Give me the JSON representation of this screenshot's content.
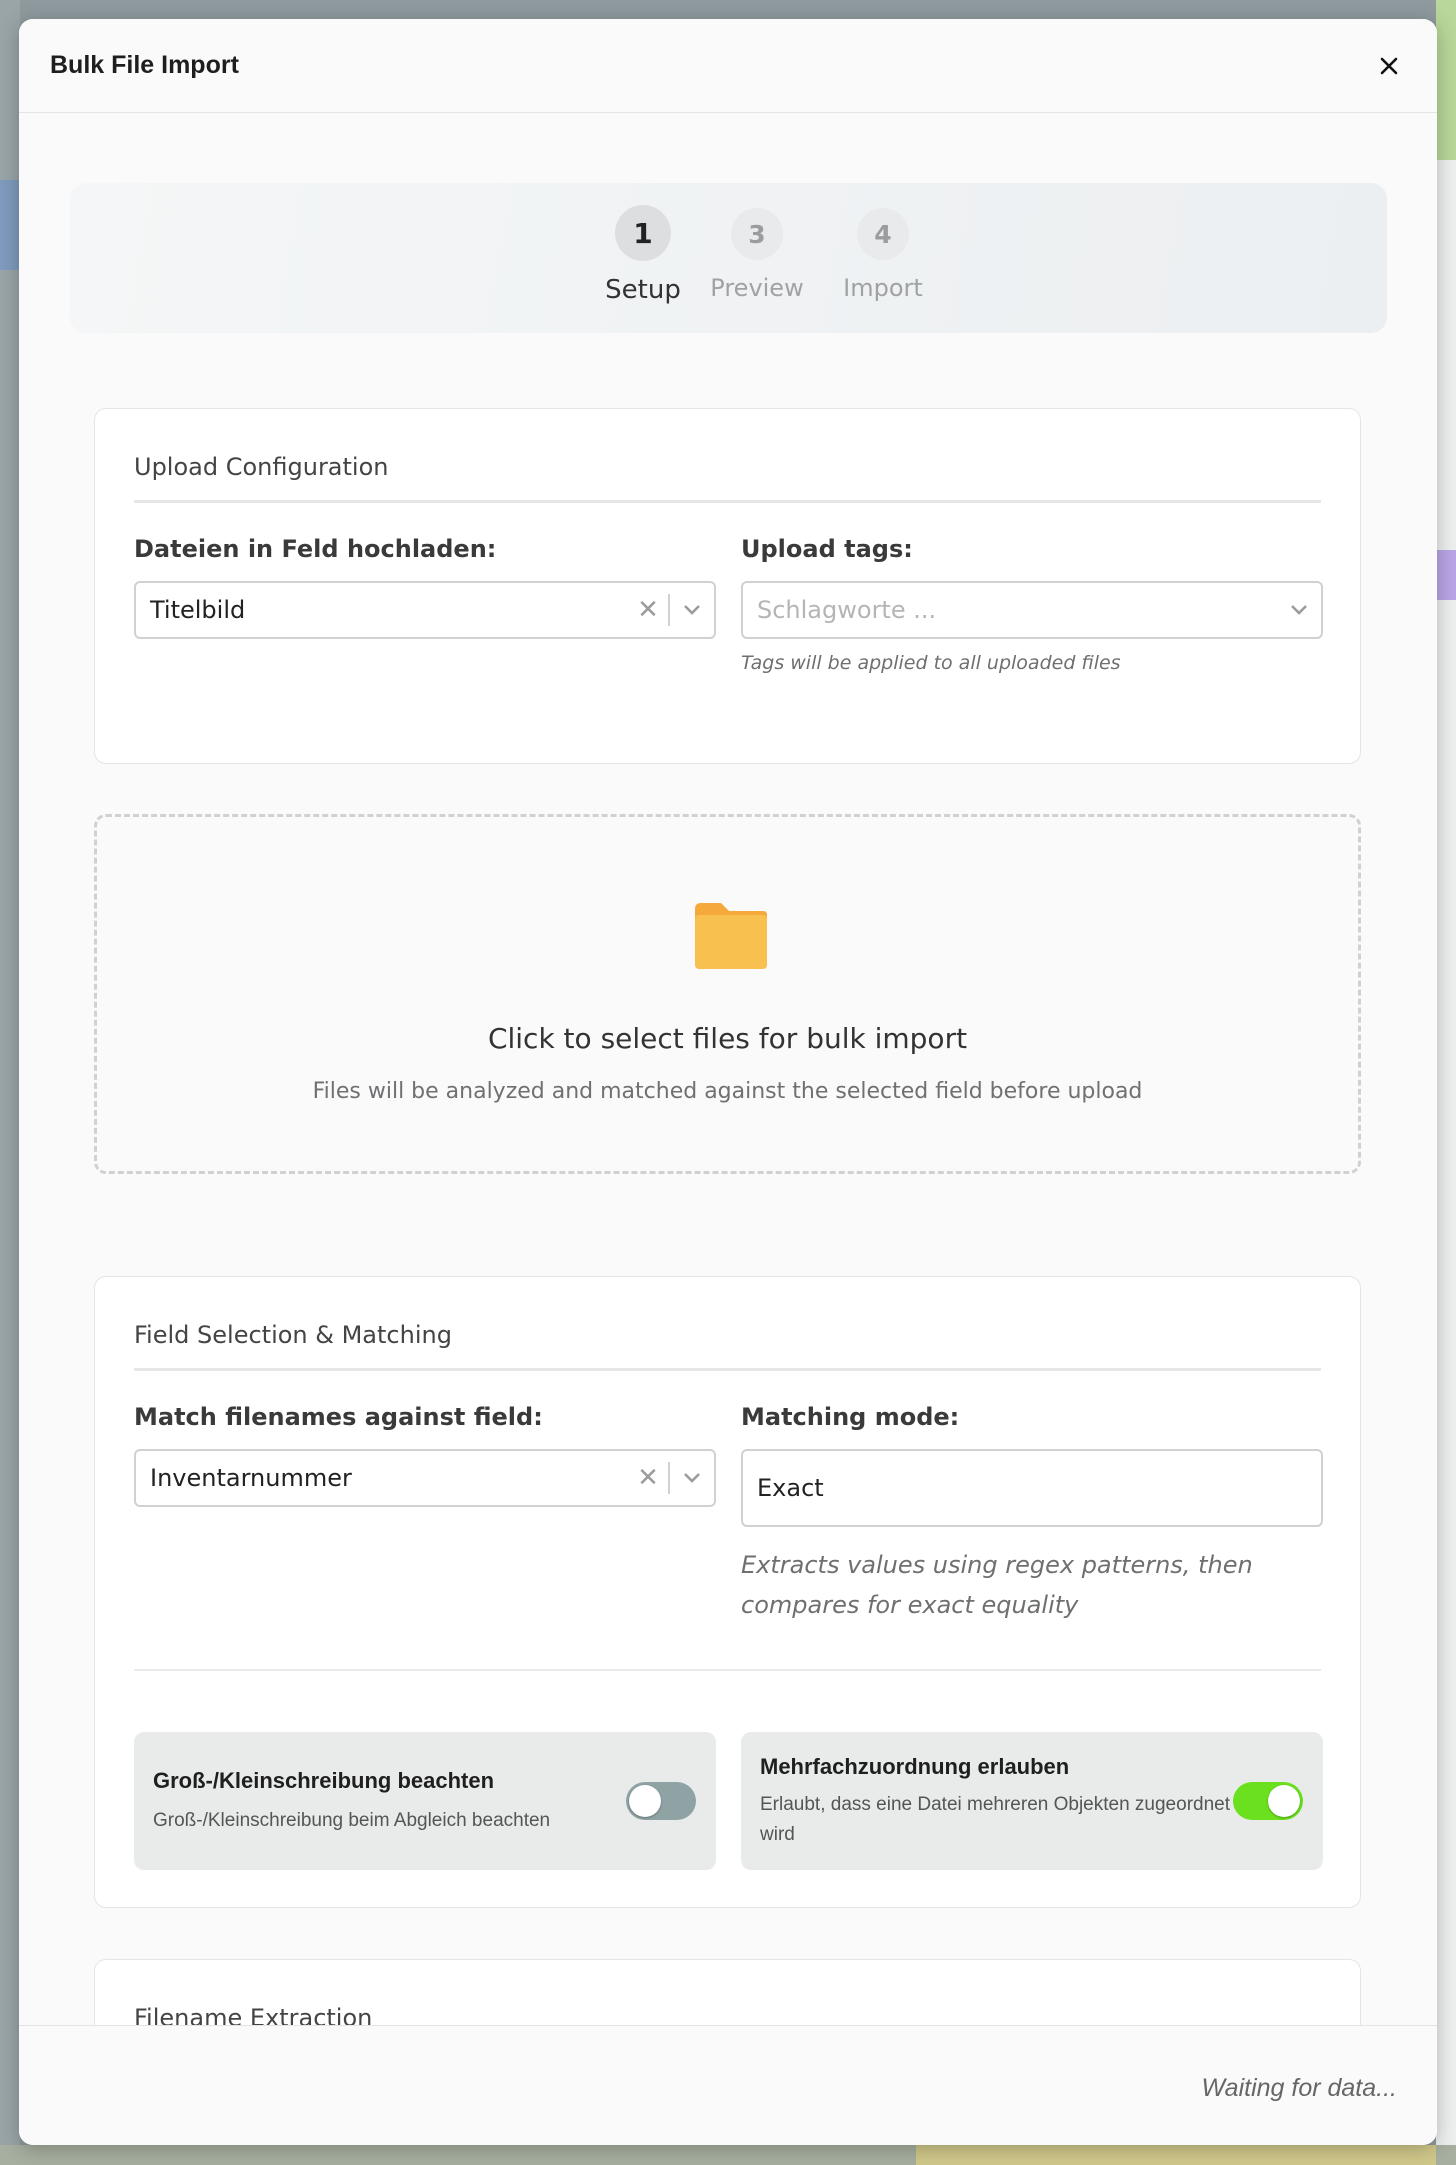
{
  "dialog": {
    "title": "Bulk File Import",
    "close_label": "×"
  },
  "stepper": {
    "steps": [
      {
        "number": "1",
        "label": "Setup",
        "state": "active"
      },
      {
        "number": "3",
        "label": "Preview",
        "state": "inactive"
      },
      {
        "number": "4",
        "label": "Import",
        "state": "inactive"
      }
    ]
  },
  "upload_config": {
    "title": "Upload Configuration",
    "field_label": "Dateien in Feld hochladen:",
    "field_value": "Titelbild",
    "tags_label": "Upload tags:",
    "tags_placeholder": "Schlagworte ...",
    "tags_help": "Tags will be applied to all uploaded files"
  },
  "dropzone": {
    "icon": "folder-icon",
    "title": "Click to select files for bulk import",
    "subtitle": "Files will be analyzed and matched against the selected field before upload"
  },
  "field_matching": {
    "title": "Field Selection & Matching",
    "match_label": "Match filenames against field:",
    "match_value": "Inventarnummer",
    "mode_label": "Matching mode:",
    "mode_value": "Exact",
    "mode_help": "Extracts values using regex patterns, then compares for exact equality",
    "case_sensitive": {
      "title": "Groß-/Kleinschreibung beachten",
      "description": "Groß-/Kleinschreibung beim Abgleich beachten",
      "enabled": false
    },
    "multi_assign": {
      "title": "Mehrfachzuordnung erlauben",
      "description": "Erlaubt, dass eine Datei mehreren Objekten zugeordnet wird",
      "enabled": true
    }
  },
  "filename_extraction": {
    "title": "Filename Extraction"
  },
  "footer": {
    "status": "Waiting for data..."
  },
  "colors": {
    "toggle_on": "#6be01e",
    "toggle_off": "#8fa3a5",
    "folder": "#f6b93b"
  }
}
